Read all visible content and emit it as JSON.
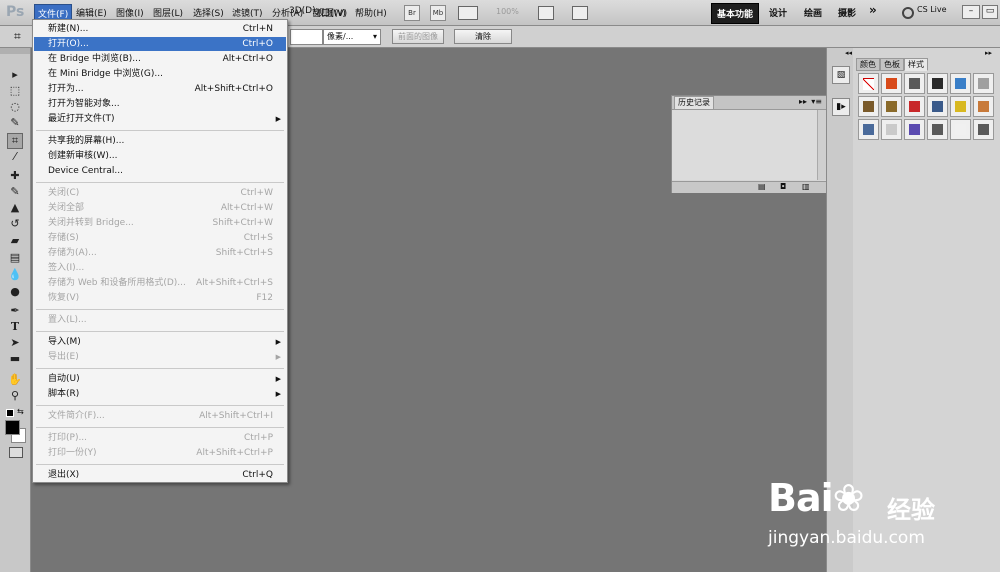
{
  "app": {
    "logo": "Ps"
  },
  "menubar": {
    "items": [
      "文件(F)",
      "编辑(E)",
      "图像(I)",
      "图层(L)",
      "选择(S)",
      "滤镜(T)",
      "分析(A)",
      "3D(D)",
      "视图(V)",
      "窗口(W)",
      "帮助(H)"
    ],
    "br": "Br",
    "mb": "Mb",
    "zoom": "100%",
    "workspaces": [
      "基本功能",
      "设计",
      "绘画",
      "摄影"
    ],
    "more": "»",
    "cslive": "CS Live"
  },
  "optbar": {
    "unit": "像素/...",
    "front_image_button": "前面的图像",
    "clear_button": "清除"
  },
  "file_menu": {
    "groups": [
      [
        {
          "label": "新建(N)...",
          "shortcut": "Ctrl+N"
        },
        {
          "label": "打开(O)...",
          "shortcut": "Ctrl+O",
          "highlight": true
        },
        {
          "label": "在 Bridge 中浏览(B)...",
          "shortcut": "Alt+Ctrl+O"
        },
        {
          "label": "在 Mini Bridge 中浏览(G)...",
          "shortcut": ""
        },
        {
          "label": "打开为...",
          "shortcut": "Alt+Shift+Ctrl+O"
        },
        {
          "label": "打开为智能对象...",
          "shortcut": ""
        },
        {
          "label": "最近打开文件(T)",
          "shortcut": "",
          "submenu": true
        }
      ],
      [
        {
          "label": "共享我的屏幕(H)...",
          "shortcut": ""
        },
        {
          "label": "创建新审核(W)...",
          "shortcut": ""
        },
        {
          "label": "Device Central...",
          "shortcut": ""
        }
      ],
      [
        {
          "label": "关闭(C)",
          "shortcut": "Ctrl+W",
          "disabled": true
        },
        {
          "label": "关闭全部",
          "shortcut": "Alt+Ctrl+W",
          "disabled": true
        },
        {
          "label": "关闭并转到 Bridge...",
          "shortcut": "Shift+Ctrl+W",
          "disabled": true
        },
        {
          "label": "存储(S)",
          "shortcut": "Ctrl+S",
          "disabled": true
        },
        {
          "label": "存储为(A)...",
          "shortcut": "Shift+Ctrl+S",
          "disabled": true
        },
        {
          "label": "签入(I)...",
          "shortcut": "",
          "disabled": true
        },
        {
          "label": "存储为 Web 和设备所用格式(D)...",
          "shortcut": "Alt+Shift+Ctrl+S",
          "disabled": true
        },
        {
          "label": "恢复(V)",
          "shortcut": "F12",
          "disabled": true
        }
      ],
      [
        {
          "label": "置入(L)...",
          "shortcut": "",
          "disabled": true
        }
      ],
      [
        {
          "label": "导入(M)",
          "shortcut": "",
          "submenu": true
        },
        {
          "label": "导出(E)",
          "shortcut": "",
          "submenu": true,
          "disabled": true
        }
      ],
      [
        {
          "label": "自动(U)",
          "shortcut": "",
          "submenu": true
        },
        {
          "label": "脚本(R)",
          "shortcut": "",
          "submenu": true
        }
      ],
      [
        {
          "label": "文件简介(F)...",
          "shortcut": "Alt+Shift+Ctrl+I",
          "disabled": true
        }
      ],
      [
        {
          "label": "打印(P)...",
          "shortcut": "Ctrl+P",
          "disabled": true
        },
        {
          "label": "打印一份(Y)",
          "shortcut": "Alt+Shift+Ctrl+P",
          "disabled": true
        }
      ],
      [
        {
          "label": "退出(X)",
          "shortcut": "Ctrl+Q"
        }
      ]
    ]
  },
  "panels": {
    "tabs": [
      "颜色",
      "色板",
      "样式"
    ],
    "history_title": "历史记录"
  },
  "styles_swatches": [
    "#ffffff",
    "#d84a1a",
    "#5a5a5a",
    "#2a2a2a",
    "#3a7fc8",
    "#a0a0a0",
    "#7a5a2a",
    "#8a6a2a",
    "#c8282a",
    "#3a5a8a",
    "#d8b820",
    "#c87a3a",
    "#4a6a9a",
    "#cacaca",
    "#5a4ab0",
    "#5a5a5a",
    "#f0f0f0",
    "#5a5a5a"
  ],
  "watermark": {
    "brand": "Bai",
    "brand2": "百",
    "brand3": "经验",
    "url": "jingyan.baidu.com"
  }
}
